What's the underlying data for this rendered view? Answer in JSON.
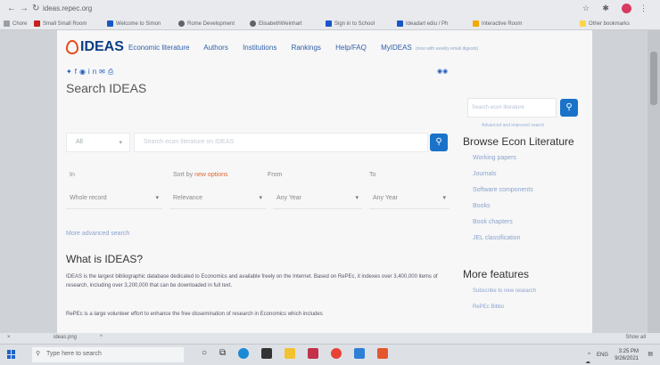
{
  "browser": {
    "url": "ideas.repec.org",
    "bookmarks": [
      "Chore",
      "Small Small Room",
      "Welcome to Simon",
      "Rome Development",
      "ElisabethWeinhart",
      "Sign in to School",
      "Ideadart ediu / Ph",
      "Interactive Room",
      "Other bookmarks"
    ]
  },
  "site": {
    "logo": "IDEAS",
    "nav": [
      "Economic literature",
      "Authors",
      "Institutions",
      "Rankings",
      "Help/FAQ",
      "MyIDEAS"
    ],
    "nav_note": "(now with weekly email digests)",
    "social_icons": [
      "twitter-icon",
      "facebook-icon",
      "rss-icon",
      "linkedin-icon",
      "email-icon",
      "print-icon"
    ]
  },
  "search": {
    "title": "Search IDEAS",
    "scope_value": "All",
    "placeholder": "Search econ literature on IDEAS",
    "in_label": "In",
    "sort_label_pre": "Sort by",
    "sort_label_link": "new options",
    "from_label": "From",
    "to_label": "To",
    "in_value": "Whole record",
    "sort_value": "Relevance",
    "from_value": "Any Year",
    "to_value": "Any Year",
    "more_link": "More advanced search"
  },
  "sidebar": {
    "search_placeholder": "Search econ literature",
    "advanced_link": "Advanced and improved search",
    "browse_title": "Browse Econ Literature",
    "browse_items": [
      "Working papers",
      "Journals",
      "Software components",
      "Books",
      "Book chapters",
      "JEL classification"
    ],
    "more_title": "More features",
    "more_items": [
      "Subscribe to new research",
      "RePEc Biblio"
    ]
  },
  "about": {
    "title": "What is IDEAS?",
    "para1": "IDEAS is the largest bibliographic database dedicated to Economics and available freely on the Internet. Based on RePEc, it indexes over 3,400,000 items of research, including over 3,200,000 that can be downloaded in full text.",
    "para2": "RePEc is a large volunteer effort to enhance the free dissemination of research in Economics which includes"
  },
  "statusbar": {
    "download": "ideas.png",
    "show_all": "Show all"
  },
  "taskbar": {
    "search_placeholder": "Type here to search",
    "lang": "ENG",
    "time": "3:25 PM",
    "date": "9/26/2021"
  }
}
